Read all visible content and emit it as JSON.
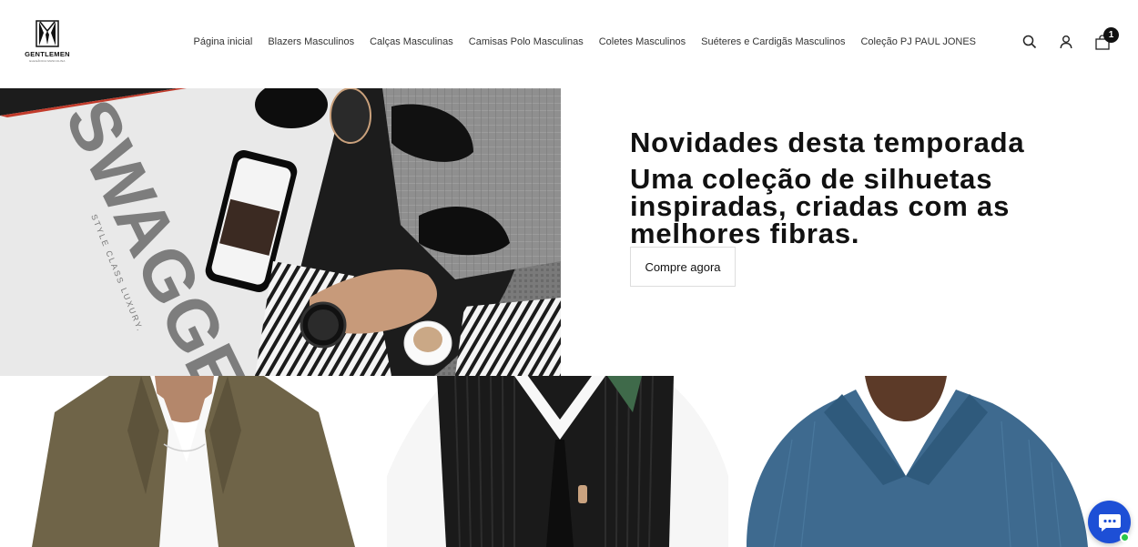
{
  "brand": {
    "name": "GENTLEMEN",
    "tagline": "ELEGÂNCIA MASCULINA"
  },
  "nav": {
    "items": [
      {
        "label": "Página inicial"
      },
      {
        "label": "Blazers Masculinos"
      },
      {
        "label": "Calças Masculinas"
      },
      {
        "label": "Camisas Polo Masculinas"
      },
      {
        "label": "Coletes Masculinos"
      },
      {
        "label": "Suéteres e Cardigãs Masculinos"
      },
      {
        "label": "Coleção PJ PAUL JONES"
      }
    ]
  },
  "header_icons": {
    "search": "search-icon",
    "account": "user-icon",
    "cart": "bag-icon",
    "cart_count": "1"
  },
  "hero": {
    "eyebrow": "Novidades desta temporada",
    "heading": "Uma coleção de silhuetas inspiradas, criadas com as melhores fibras.",
    "cta_label": "Compre agora",
    "image_text": "SWAGGER",
    "image_subtext": "STYLE CLASS LUXURY."
  },
  "tiles": [
    {
      "name": "blazer"
    },
    {
      "name": "vest"
    },
    {
      "name": "polo"
    }
  ],
  "colors": {
    "accent": "#111111",
    "chat": "#1d4fd6",
    "online": "#29c749"
  }
}
